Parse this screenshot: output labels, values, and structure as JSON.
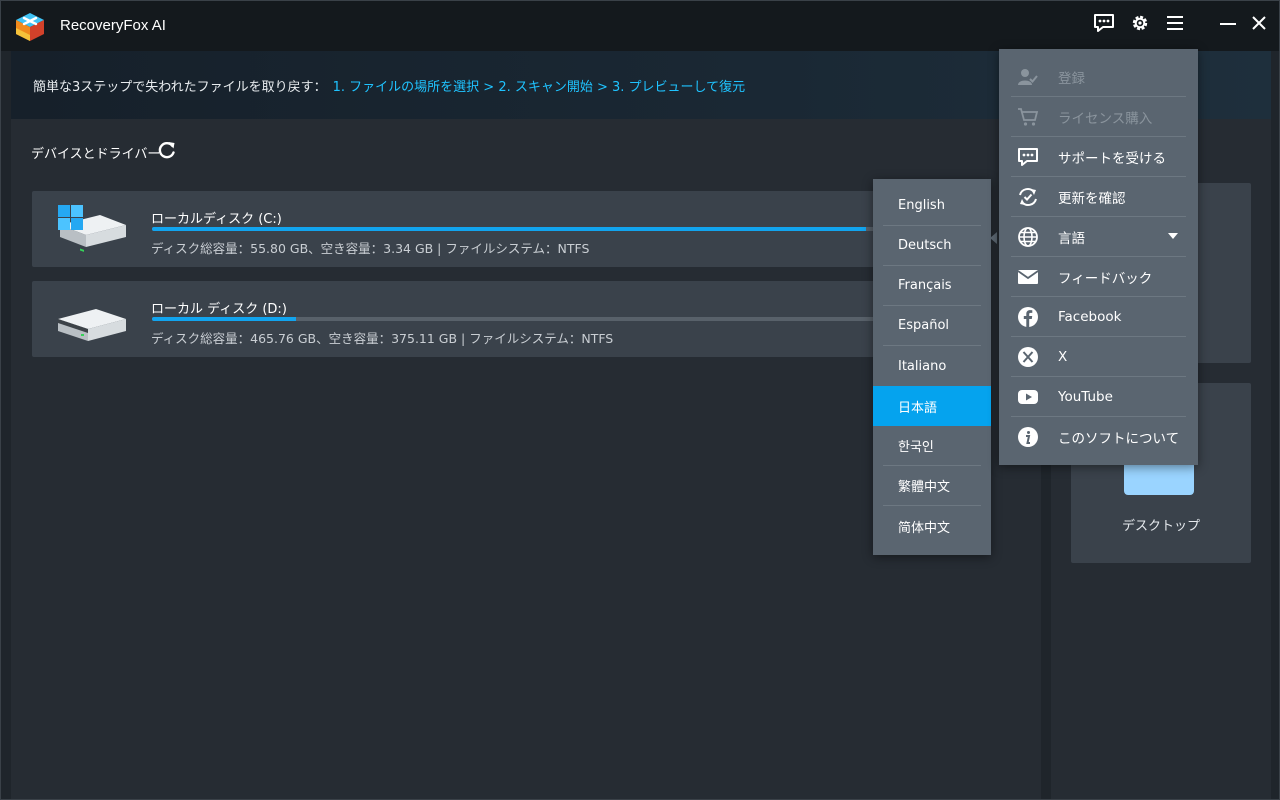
{
  "app": {
    "title": "RecoveryFox AI"
  },
  "titlebar_icons": [
    "feedback-chat-icon",
    "gear-icon",
    "hamburger-menu-icon",
    "minimize-icon",
    "close-icon"
  ],
  "banner": {
    "lead": "簡単な3ステップで失われたファイルを取り戻す：",
    "steps": "1. ファイルの場所を選択 > 2. スキャン開始 > 3. プレビューして復元"
  },
  "devices": {
    "title": "デバイスとドライバー",
    "disks": [
      {
        "name": "ローカルディスク (C:)",
        "info": "ディスク総容量：55.80 GB、空き容量：3.34 GB | ファイルシステム：NTFS",
        "used_fraction": 0.94,
        "icon": "windows-drive-icon"
      },
      {
        "name": "ローカル ディスク (D:)",
        "info": "ディスク総容量：465.76 GB、空き容量：375.11 GB | ファイルシステム：NTFS",
        "used_fraction": 0.19,
        "icon": "drive-icon"
      }
    ]
  },
  "locations": {
    "desktop_label": "デスクトップ"
  },
  "main_menu": {
    "items": [
      {
        "label": "登録",
        "icon": "user-check-icon",
        "disabled": true
      },
      {
        "label": "ライセンス購入",
        "icon": "cart-icon",
        "disabled": true
      },
      {
        "label": "サポートを受ける",
        "icon": "support-chat-icon",
        "disabled": false
      },
      {
        "label": "更新を確認",
        "icon": "update-icon",
        "disabled": false
      },
      {
        "label": "言語",
        "icon": "globe-icon",
        "disabled": false,
        "submenu": true
      },
      {
        "label": "フィードバック",
        "icon": "mail-icon",
        "disabled": false
      },
      {
        "label": "Facebook",
        "icon": "facebook-icon",
        "disabled": false
      },
      {
        "label": "X",
        "icon": "x-icon",
        "disabled": false
      },
      {
        "label": "YouTube",
        "icon": "youtube-icon",
        "disabled": false
      },
      {
        "label": "このソフトについて",
        "icon": "info-icon",
        "disabled": false
      }
    ]
  },
  "language_menu": {
    "selected": "日本語",
    "items": [
      "English",
      "Deutsch",
      "Français",
      "Español",
      "Italiano",
      "日本語",
      "한국인",
      "繁體中文",
      "简体中文"
    ]
  },
  "colors": {
    "accent": "#05a3ee",
    "steps_text": "#1fc3ff",
    "menu_bg": "#5a6570",
    "window_bg": "#1f252b"
  }
}
